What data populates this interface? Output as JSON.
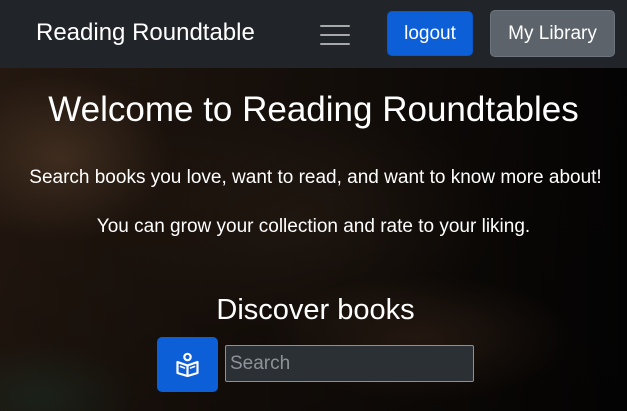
{
  "navbar": {
    "brand": "Reading Roundtable",
    "logout_label": "logout",
    "library_label": "My Library"
  },
  "hero": {
    "title": "Welcome to Reading Roundtables",
    "line1": "Search books you love, want to read, and want to know more about!",
    "line2": "You can grow your collection and rate to your liking."
  },
  "discover": {
    "title": "Discover books",
    "search_placeholder": "Search",
    "search_value": "",
    "search_button_icon": "book-reader-icon"
  },
  "colors": {
    "navbar_bg": "#212529",
    "primary": "#0d5fd8",
    "secondary": "#5c636a"
  }
}
